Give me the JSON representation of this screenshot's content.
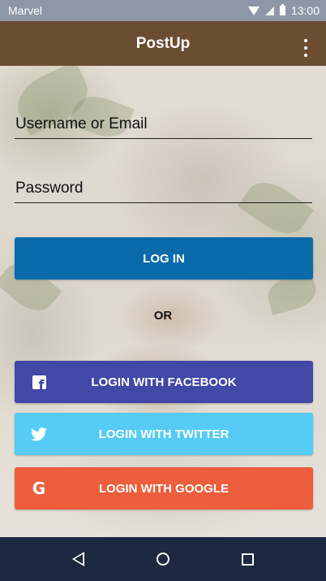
{
  "status_bar": {
    "carrier": "Marvel",
    "time": "13:00"
  },
  "app_bar": {
    "title": "PostUp"
  },
  "form": {
    "username_placeholder": "Username or Email",
    "password_placeholder": "Password",
    "login_label": "LOG IN",
    "or_label": "OR"
  },
  "social": {
    "facebook_label": "LOGIN WITH FACEBOOK",
    "twitter_label": "LOGIN WITH TWITTER",
    "google_label": "LOGIN WITH GOOGLE"
  },
  "icons": {
    "wifi": "wifi-icon",
    "signal": "signal-icon",
    "battery": "battery-icon",
    "menu": "more-vert-icon",
    "facebook": "facebook-icon",
    "twitter": "twitter-icon",
    "google": "google-icon",
    "back": "back-icon",
    "home": "home-icon",
    "recents": "recents-icon"
  },
  "colors": {
    "app_bar": "#6b4e32",
    "login": "#0b6aaa",
    "facebook": "#4148a6",
    "twitter": "#55cbf5",
    "google": "#ec5e3c",
    "nav_bar": "#1c2940",
    "status_bar": "#8e97a8"
  }
}
